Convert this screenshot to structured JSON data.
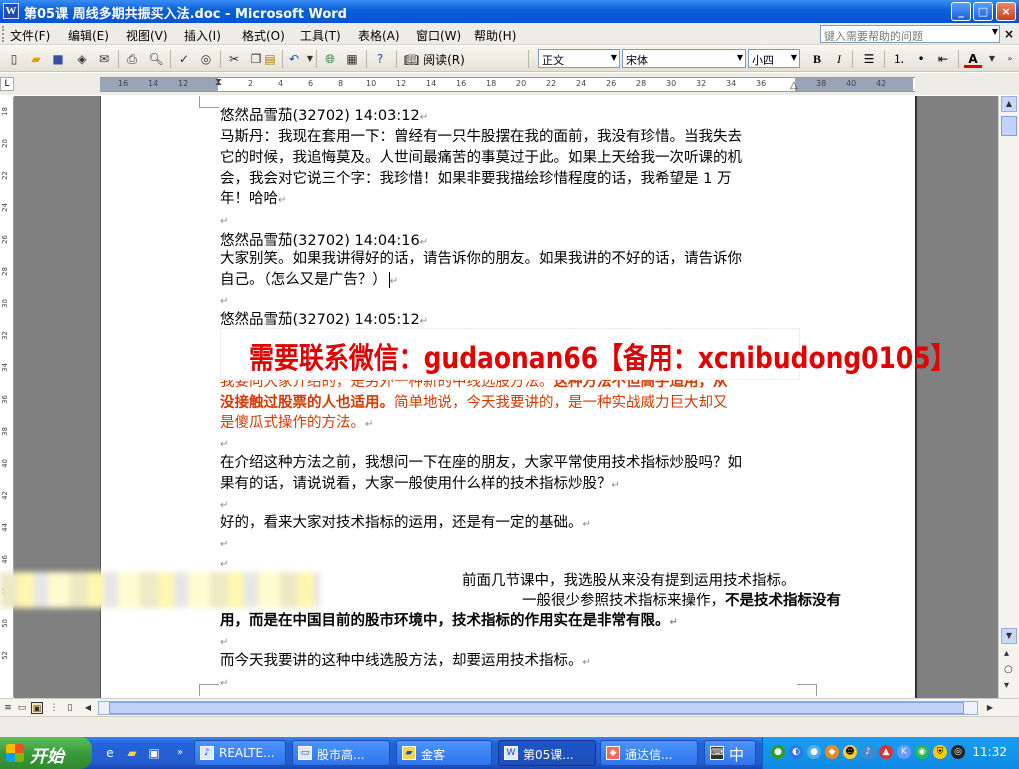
{
  "window": {
    "title": "第05课    周线多期共振买入法.doc - Microsoft Word",
    "app_icon": "W",
    "minimize": "_",
    "maximize": "□",
    "close": "×"
  },
  "menu": {
    "items": [
      "文件(F)",
      "编辑(E)",
      "视图(V)",
      "插入(I)",
      "格式(O)",
      "工具(T)",
      "表格(A)",
      "窗口(W)",
      "帮助(H)"
    ],
    "help_placeholder": "键入需要帮助的问题",
    "close_doc": "×"
  },
  "toolbar": {
    "read_label": "阅读(R)",
    "style_value": "正文",
    "font_value": "宋体",
    "size_value": "小四",
    "bold": "B",
    "italic": "I",
    "font_color_label": "A"
  },
  "ruler": {
    "labels": [
      "16",
      "14",
      "12",
      "",
      "2",
      "4",
      "6",
      "8",
      "10",
      "12",
      "14",
      "16",
      "18",
      "20",
      "22",
      "24",
      "26",
      "28",
      "30",
      "32",
      "34",
      "36",
      "38",
      "40",
      "42"
    ],
    "vertical_labels": [
      "18",
      "20",
      "22",
      "24",
      "26",
      "28",
      "30",
      "32",
      "34",
      "36",
      "38",
      "40",
      "42",
      "44",
      "46",
      "48",
      "50",
      "52"
    ]
  },
  "document": {
    "para_mark": "↵",
    "lines": [
      "悠然品雪茄(32702) 14:03:12",
      "马斯丹：我现在套用一下：曾经有一只牛股摆在我的面前，我没有珍惜。当我失去",
      "它的时候，我追悔莫及。人世间最痛苦的事莫过于此。如果上天给我一次听课的机",
      "会，我会对它说三个字：我珍惜！如果非要我描绘珍惜程度的话，我希望是 1 万",
      "年！哈哈",
      "",
      "悠然品雪茄(32702) 14:04:16",
      "大家别笑。如果我讲得好的话，请告诉你的朋友。如果我讲的不好的话，请告诉你",
      "自己。（怎么又是广告？）",
      "",
      "悠然品雪茄(32702) 14:05:12"
    ],
    "red_partial_line_left": "我要向大家介绍的，是另外一种新的中线选股方法。",
    "red_partial_line_bold": "这种方法不但高手适用，从",
    "red_line2_bold": "没接触过股票的人也适用。",
    "red_line2_normal": "简单地说，今天我要讲的，是一种实战威力巨大却又",
    "red_line3": "是傻瓜式操作的方法。",
    "lines_after": [
      "在介绍这种方法之前，我想问一下在座的朋友，大家平常使用技术指标炒股吗？如",
      "果有的话，请说说看，大家一般使用什么样的技术指标炒股？",
      "",
      "好的，看来大家对技术指标的运用，还是有一定的基础。",
      "",
      ""
    ],
    "partial_line_a": "前面几节课中，我选股从来没有提到运用技术指标。",
    "partial_line_b": "一般很少参照技术指标来操作，",
    "partial_line_b_bold": "不是技术指标没有",
    "bold_line": "用，而是在中国目前的股市环境中，技术指标的作用实在是非常有限。",
    "last_line_blank": "",
    "final_line": "而今天我要讲的这种中线选股方法，却要运用技术指标。"
  },
  "banner": {
    "text": "需要联系微信：gudaonan66【备用：xcnibudong0105】"
  },
  "taskbar": {
    "start": "开始",
    "tasks": [
      "REALTE...",
      "股市高...",
      "金客",
      "第05课...",
      "通达信...",
      "中"
    ],
    "clock": "11:32"
  },
  "colors": {
    "title_blue": "#0554d0",
    "red_text": "#d23a00",
    "banner_red": "#e00000",
    "taskbar_blue": "#245cd0",
    "start_green": "#3a9a3a"
  }
}
